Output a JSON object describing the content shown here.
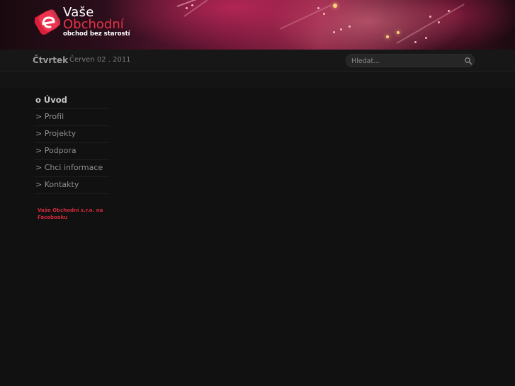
{
  "brand": {
    "name_line1": "Vaše",
    "name_line2": "Obchodní",
    "tagline": "obchod bez starostí",
    "accent_color": "#e8334a",
    "logo_icon": "e-logo-icon"
  },
  "datebar": {
    "day": "Čtvrtek",
    "date": "Červen 02 . 2011"
  },
  "search": {
    "placeholder": "Hledat...",
    "value": "",
    "icon": "search-icon"
  },
  "nav": {
    "items": [
      {
        "label": "o Úvod",
        "active": true
      },
      {
        "label": "> Profil",
        "active": false
      },
      {
        "label": "> Projekty",
        "active": false
      },
      {
        "label": "> Podpora",
        "active": false
      },
      {
        "label": "> Chci informace",
        "active": false
      },
      {
        "label": "> Kontakty",
        "active": false
      }
    ]
  },
  "facebook_link": "Vaše Obchodní s.r.o. na Facebooku"
}
